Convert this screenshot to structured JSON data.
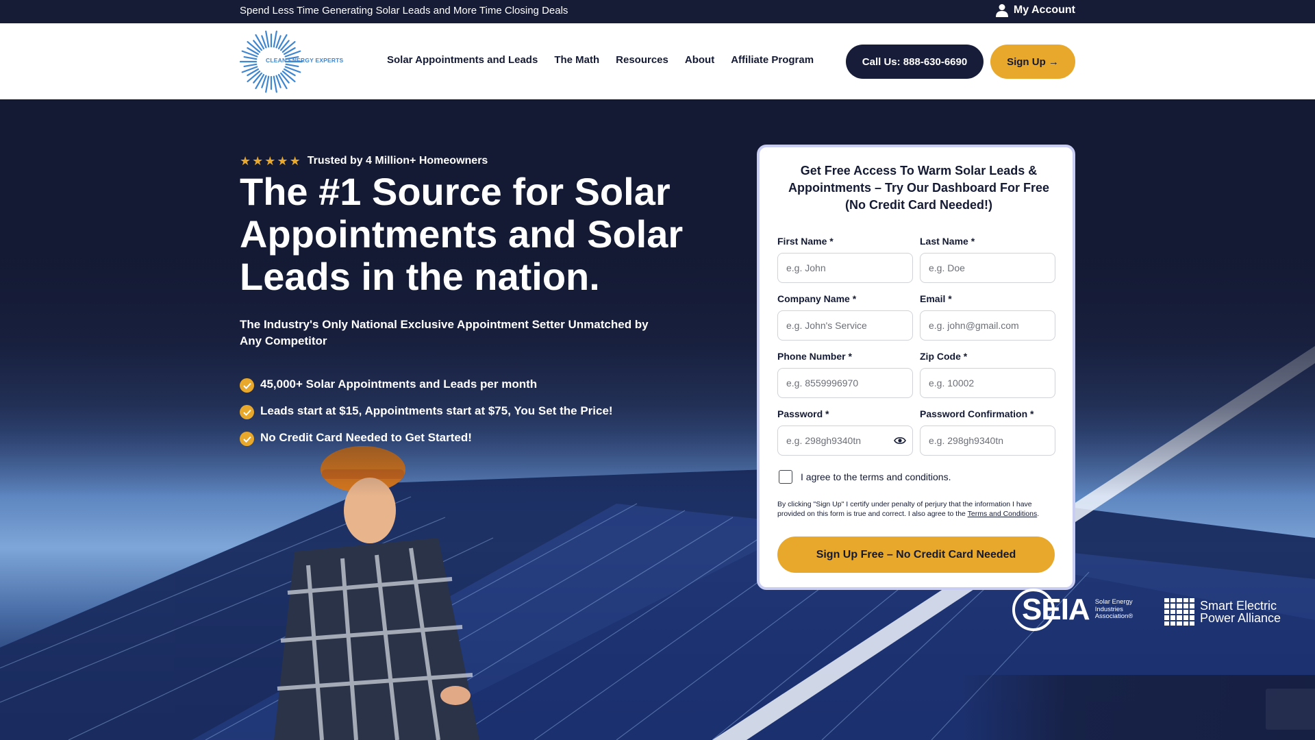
{
  "topbar": {
    "tagline": "Spend Less Time Generating Solar Leads and More Time Closing Deals",
    "account_label": "My Account"
  },
  "header": {
    "logo_text": "CLEAN ENERGY EXPERTS",
    "nav": [
      {
        "label": "Solar Appointments and Leads"
      },
      {
        "label": "The Math"
      },
      {
        "label": "Resources"
      },
      {
        "label": "About"
      },
      {
        "label": "Affiliate Program"
      }
    ],
    "call_label": "Call Us: 888-630-6690",
    "signup_label": "Sign Up →"
  },
  "hero": {
    "stars": 5,
    "trust_text": "Trusted by 4 Million+ Homeowners",
    "headline": "The #1 Source for Solar Appointments and Solar Leads in the nation.",
    "subhead": "The Industry's Only National Exclusive Appointment Setter Unmatched by Any Competitor",
    "bullets": [
      {
        "text": "45,000+ Solar Appointments and Leads per month"
      },
      {
        "text": "Leads start at $15, Appointments start at $75, You Set the Price!"
      },
      {
        "text": "No Credit Card Needed to Get Started!"
      }
    ]
  },
  "form": {
    "title": "Get Free Access To Warm Solar Leads & Appointments – Try Our Dashboard For Free (No Credit Card Needed!)",
    "first_name": {
      "label": "First Name *",
      "placeholder": "e.g. John",
      "value": ""
    },
    "last_name": {
      "label": "Last Name *",
      "placeholder": "e.g. Doe",
      "value": ""
    },
    "company": {
      "label": "Company Name *",
      "placeholder": "e.g. John's Service",
      "value": ""
    },
    "email": {
      "label": "Email *",
      "placeholder": "e.g. john@gmail.com",
      "value": ""
    },
    "phone": {
      "label": "Phone Number *",
      "placeholder": "e.g. 8559996970",
      "value": ""
    },
    "zip": {
      "label": "Zip Code *",
      "placeholder": "e.g. 10002",
      "value": ""
    },
    "password": {
      "label": "Password *",
      "placeholder": "e.g. 298gh9340tn",
      "value": ""
    },
    "password_confirm": {
      "label": "Password Confirmation *",
      "placeholder": "e.g. 298gh9340tn",
      "value": ""
    },
    "agree_label": "I agree to the terms and conditions.",
    "legal_text": "By clicking \"Sign Up\" I certify under penalty of perjury that the information I have provided on this form is true and correct. I also agree to the",
    "legal_link": "Terms and Conditions",
    "legal_end": ".",
    "submit_label": "Sign Up Free – No Credit Card Needed"
  },
  "partners": {
    "seia_word": "SEIA",
    "seia_small": "Solar Energy Industries Association®",
    "sepa_text_1": "Smart Electric",
    "sepa_text_2": "Power Alliance"
  },
  "colors": {
    "navy": "#141a33",
    "gold": "#e8a82b",
    "white": "#ffffff",
    "logo_blue": "#3f86d0"
  },
  "icons": [
    "user-icon",
    "star-icon",
    "check-icon",
    "eye-icon",
    "sunburst-logo-icon",
    "arrow-right-icon"
  ]
}
